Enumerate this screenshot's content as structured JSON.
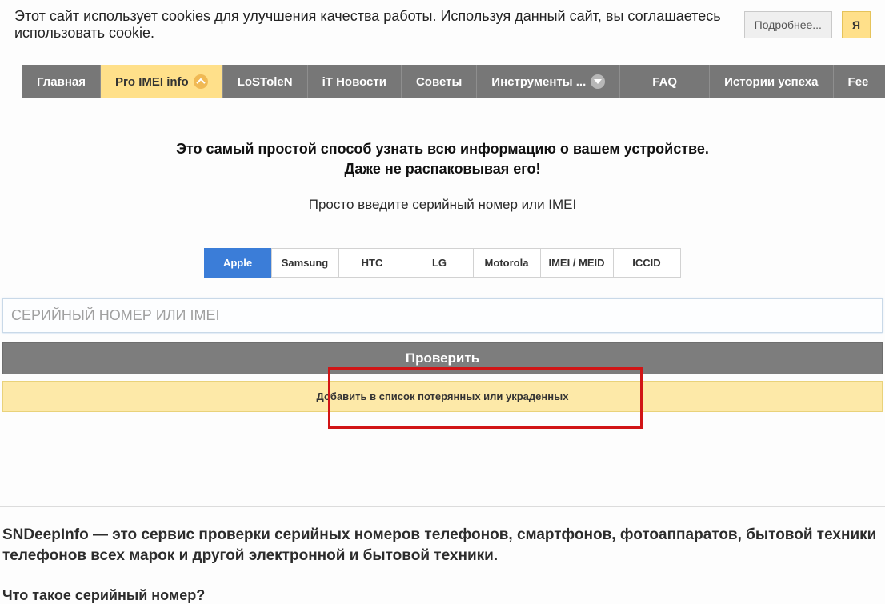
{
  "cookie": {
    "text": "Этот сайт использует cookies для улучшения качества работы. Используя данный сайт, вы соглашаетесь использовать cookie.",
    "more": "Подробнее...",
    "yes": "Я"
  },
  "nav": {
    "items": [
      {
        "label": "Главная"
      },
      {
        "label": "Pro IMEI info"
      },
      {
        "label": "LoSToleN"
      },
      {
        "label": "iT Новости"
      },
      {
        "label": "Советы"
      },
      {
        "label": "Инструменты ..."
      },
      {
        "label": "FAQ"
      },
      {
        "label": "Истории успеха"
      },
      {
        "label": "Fee"
      }
    ]
  },
  "hero": {
    "line1": "Это самый простой способ узнать всю информацию о вашем устройстве.",
    "line2": "Даже не распаковывая его!",
    "sub": "Просто введите серийный номер или IMEI"
  },
  "tabs": {
    "items": [
      "Apple",
      "Samsung",
      "HTC",
      "LG",
      "Motorola",
      "IMEI / MEID",
      "ICCID"
    ]
  },
  "form": {
    "placeholder": "СЕРИЙНЫЙ НОМЕР ИЛИ IMEI",
    "check": "Проверить",
    "add": "Добавить в список потерянных или украденных"
  },
  "info": {
    "title": "SNDeepInfo — это сервис проверки серийных номеров телефонов, смартфонов, фотоаппаратов, бытовой техники телефонов всех марок и другой электронной и бытовой техники.",
    "sub": "Что такое серийный номер?"
  }
}
